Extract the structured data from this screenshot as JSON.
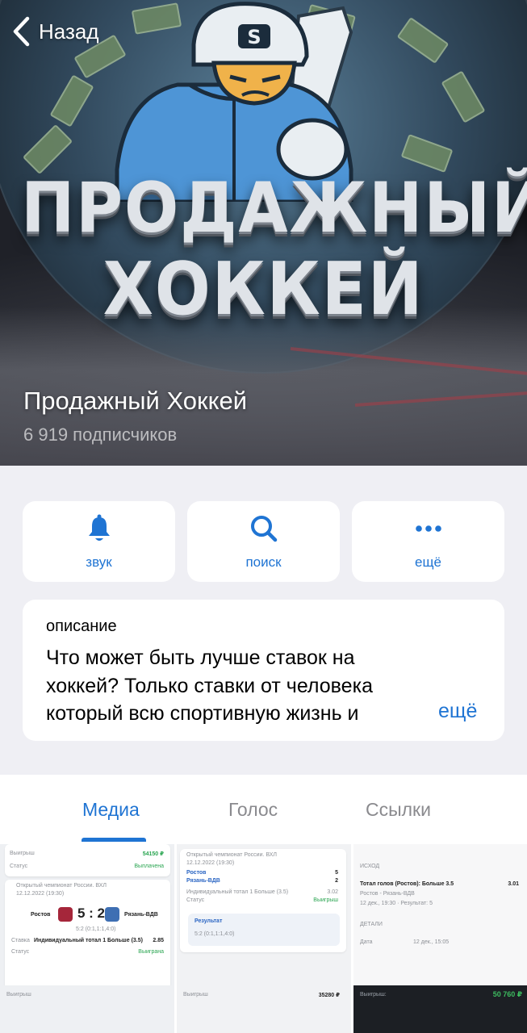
{
  "nav": {
    "back_label": "Назад"
  },
  "channel": {
    "name": "Продажный Хоккей",
    "subscribers": "6 919 подписчиков",
    "logo_line1": "ПРОДАЖНЫЙ",
    "logo_line2": "ХОККЕЙ",
    "helmet_letter": "S"
  },
  "actions": [
    {
      "label": "звук",
      "icon": "bell-icon"
    },
    {
      "label": "поиск",
      "icon": "search-icon"
    },
    {
      "label": "ещё",
      "icon": "more-icon"
    }
  ],
  "description": {
    "title": "описание",
    "line1": "Что может быть лучше ставок на",
    "line2": "хоккей? Только ставки от человека",
    "line3": "который всю спортивную жизнь и",
    "more": "ещё"
  },
  "tabs": [
    {
      "label": "Медиа",
      "active": true
    },
    {
      "label": "Голос",
      "active": false
    },
    {
      "label": "Ссылки",
      "active": false
    }
  ],
  "media": {
    "cell1": {
      "win_label": "Выигрыш",
      "win_value": "54150 ₽",
      "status_label": "Статус",
      "status_value": "Выплачена",
      "league": "Открытый чемпионат России. ВХЛ",
      "date": "12.12.2022 (19:30)",
      "team1": "Ростов",
      "score": "5 : 2",
      "team2": "Рязань-ВДВ",
      "periods": "5:2 (0:1,1:1,4:0)",
      "bet_label": "Ставка",
      "bet_value": "Индивидуальный тотал 1 Больше (3.5)",
      "odds": "2.85",
      "status2_label": "Статус",
      "status2_value": "Выиграна"
    },
    "cell2": {
      "league": "Открытый чемпионат России. ВХЛ",
      "date": "12.12.2022 (19:30)",
      "team1": "Ростов",
      "team1_score": "5",
      "team2": "Рязань-ВДВ",
      "team2_score": "2",
      "bet": "Индивидуальный тотал 1 Больше (3.5)",
      "odds": "3.02",
      "status_label": "Статус",
      "status_value": "Выигрыш",
      "result_label": "Результат",
      "result_value": "5:2 (0:1,1:1,4:0)"
    },
    "cell3": {
      "section": "ИСХОД",
      "bet": "Тотал голов (Ростов): Больше 3.5",
      "odds": "3.01",
      "match": "Ростов - Рязань-ВДВ",
      "when": "12 дек., 19:30 · Результат: 5",
      "details": "ДЕТАЛИ",
      "date_label": "Дата",
      "date_value": "12 дек., 15:05"
    },
    "row2": {
      "c1_label": "Выигрыш",
      "c2_label": "Выигрыш",
      "c2_value": "35280 ₽",
      "c3_label": "Выигрыш:",
      "c3_value": "50 760 ₽"
    }
  }
}
